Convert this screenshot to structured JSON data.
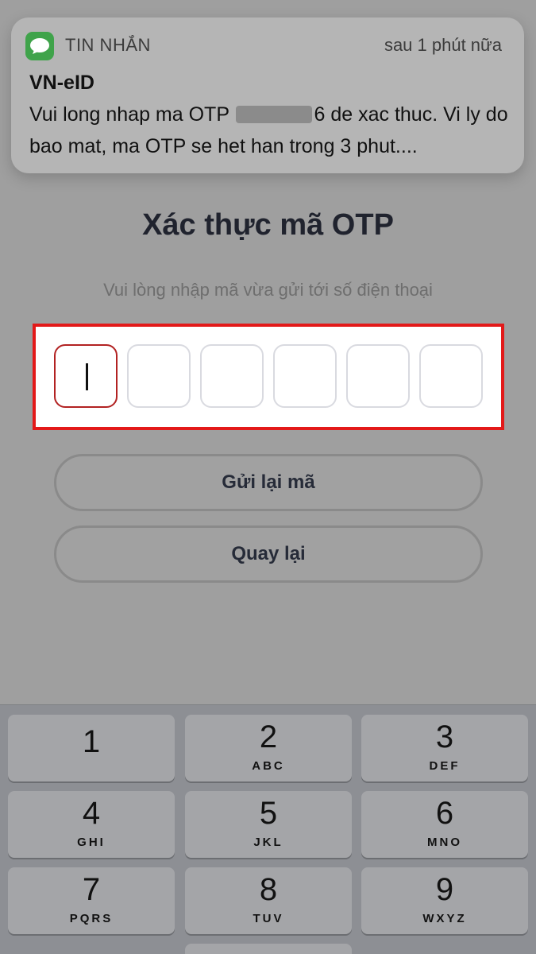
{
  "notification": {
    "app_name": "TIN NHẮN",
    "time": "sau 1 phút nữa",
    "title": "VN-eID",
    "body_before": "Vui long nhap ma OTP ",
    "body_redacted_tail": "6",
    "body_after": " de xac thuc. Vi ly do bao mat, ma OTP se het han trong 3 phut....",
    "icon": "messages-icon"
  },
  "page": {
    "title": "Xác thực mã OTP",
    "subtitle": "Vui lòng nhập mã vừa gửi tới số điện thoại"
  },
  "otp": {
    "length": 6,
    "values": [
      "",
      "",
      "",
      "",
      "",
      ""
    ],
    "active_index": 0,
    "highlight_color": "#e31919"
  },
  "buttons": {
    "resend_label": "Gửi lại mã",
    "back_label": "Quay lại"
  },
  "keyboard": {
    "keys": [
      {
        "digit": "1",
        "letters": ""
      },
      {
        "digit": "2",
        "letters": "ABC"
      },
      {
        "digit": "3",
        "letters": "DEF"
      },
      {
        "digit": "4",
        "letters": "GHI"
      },
      {
        "digit": "5",
        "letters": "JKL"
      },
      {
        "digit": "6",
        "letters": "MNO"
      },
      {
        "digit": "7",
        "letters": "PQRS"
      },
      {
        "digit": "8",
        "letters": "TUV"
      },
      {
        "digit": "9",
        "letters": "WXYZ"
      }
    ]
  }
}
